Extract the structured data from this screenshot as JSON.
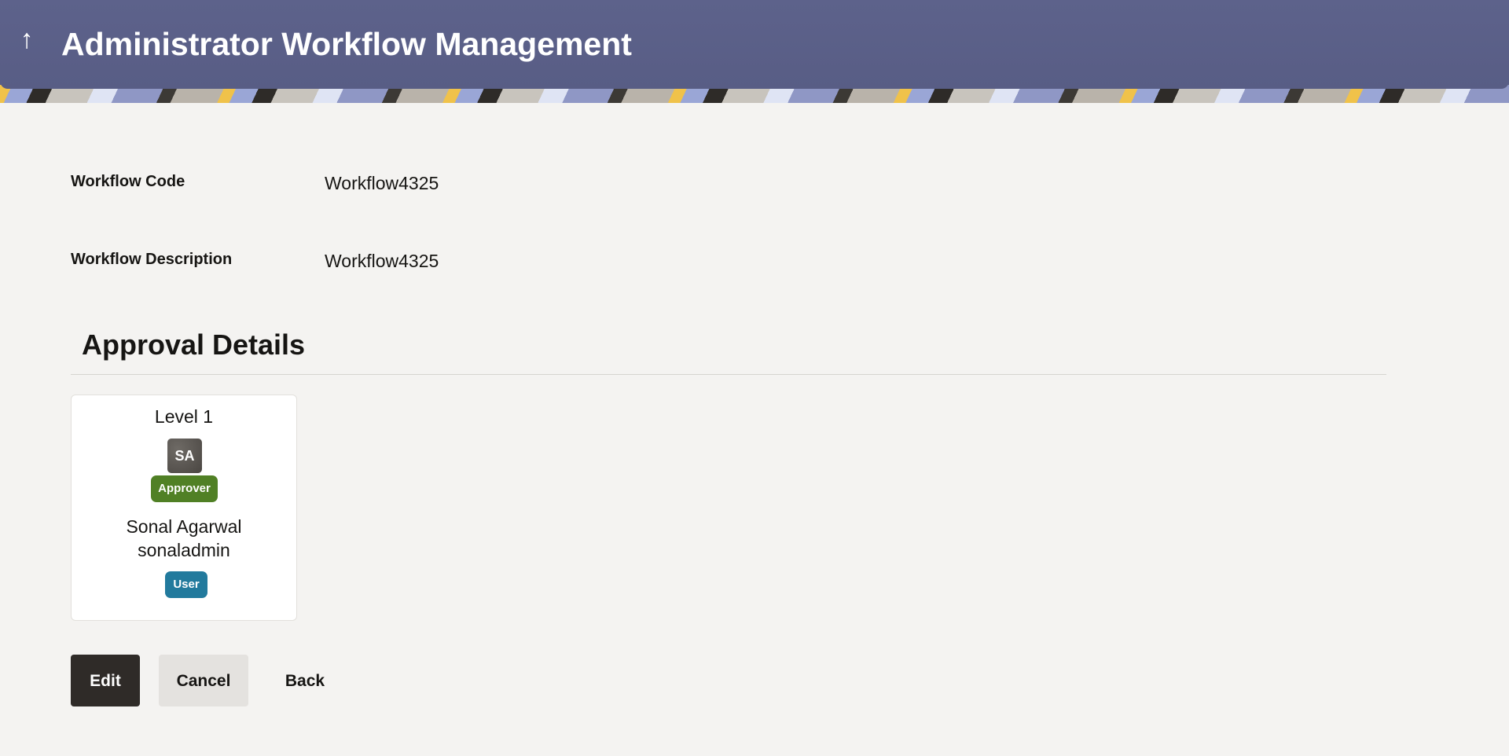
{
  "header": {
    "back_icon": "arrow-up-icon",
    "back_glyph": "↑",
    "title": "Administrator Workflow Management"
  },
  "form": {
    "workflow_code_label": "Workflow Code",
    "workflow_code_value": "Workflow4325",
    "workflow_description_label": "Workflow Description",
    "workflow_description_value": "Workflow4325"
  },
  "approval": {
    "section_title": "Approval Details",
    "levels": [
      {
        "title": "Level 1",
        "avatar_initials": "SA",
        "role_badge": "Approver",
        "user_name": "Sonal Agarwal",
        "user_id": "sonaladmin",
        "type_badge": "User"
      }
    ]
  },
  "actions": {
    "edit_label": "Edit",
    "cancel_label": "Cancel",
    "back_label": "Back"
  },
  "colors": {
    "header_bg": "#5b6088",
    "page_bg": "#f4f3f1",
    "approver_badge": "#508025",
    "user_badge": "#227a9d",
    "primary_button": "#2f2b28",
    "secondary_button": "#e4e2df"
  }
}
